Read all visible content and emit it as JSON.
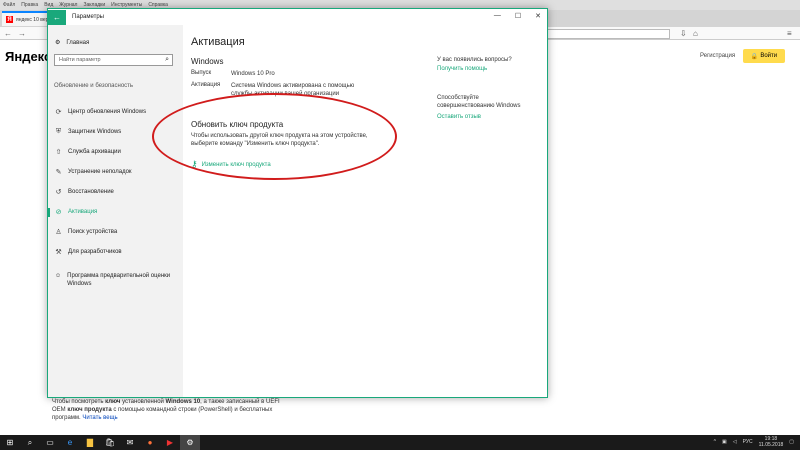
{
  "browser": {
    "menu": [
      "Файл",
      "Правка",
      "Вид",
      "Журнал",
      "Закладки",
      "Инструменты",
      "Справка"
    ],
    "tab_title": "яндекс 10 версия"
  },
  "yandex": {
    "logo": "Яндекс",
    "register": "Регистрация",
    "login": "Войти"
  },
  "article": {
    "line1_pre": "Чтобы посмотреть ",
    "line1_b1": "ключ",
    "line1_mid": " установленной ",
    "line1_b2": "Windows 10",
    "line1_post": ", а также записанный в UEFI",
    "line2_pre": "OEM ",
    "line2_b": "ключ продукта",
    "line2_post": " с помощью командной строки (PowerShell) и бесплатных",
    "line3_pre": "программ. ",
    "line3_link": "Читать вещь"
  },
  "settings": {
    "window_title": "Параметры",
    "home": "Главная",
    "search_placeholder": "Найти параметр",
    "section": "Обновление и безопасность",
    "nav": [
      {
        "label": "Центр обновления Windows",
        "icon": "refresh-icon"
      },
      {
        "label": "Защитник Windows",
        "icon": "shield-icon"
      },
      {
        "label": "Служба архивации",
        "icon": "upload-icon"
      },
      {
        "label": "Устранение неполадок",
        "icon": "wrench-icon"
      },
      {
        "label": "Восстановление",
        "icon": "history-icon"
      },
      {
        "label": "Активация",
        "icon": "check-circle-icon",
        "active": true
      },
      {
        "label": "Поиск устройства",
        "icon": "person-icon"
      },
      {
        "label": "Для разработчиков",
        "icon": "tools-icon"
      }
    ],
    "nav_insider_line1": "Программа предварительной оценки",
    "nav_insider_line2": "Windows",
    "page_title": "Активация",
    "windows_heading": "Windows",
    "edition_label": "Выпуск",
    "edition_value": "Windows 10 Pro",
    "activation_label": "Активация",
    "activation_value_1": "Система Windows активирована с помощью",
    "activation_value_2": "службы активации вашей организации",
    "update_key_title": "Обновить ключ продукта",
    "update_key_desc_1": "Чтобы использовать другой ключ продукта на этом устройстве,",
    "update_key_desc_2": "выберите команду \"Изменить ключ продукта\".",
    "change_key_link": "Изменить ключ продукта",
    "right_q": "У вас появились вопросы?",
    "right_help": "Получить помощь",
    "right_improve_1": "Способствуйте",
    "right_improve_2": "совершенствованию Windows",
    "right_feedback": "Оставить отзыв"
  },
  "taskbar": {
    "lang": "РУС",
    "time": "19:18",
    "date": "11.05.2018"
  },
  "colors": {
    "accent": "#19a87b",
    "annotation": "#d11c1c",
    "yandex_button": "#ffdb4d"
  }
}
